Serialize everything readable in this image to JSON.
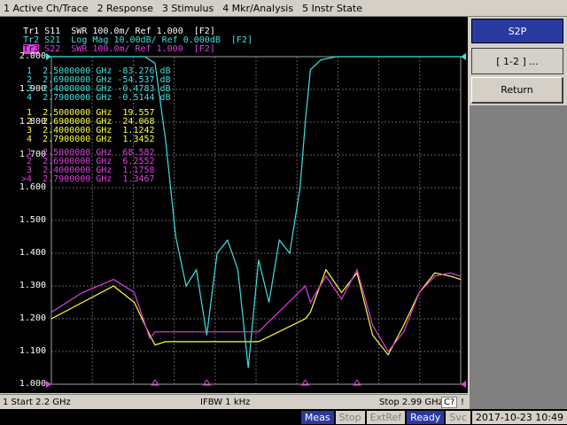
{
  "menu": {
    "items": [
      "1 Active Ch/Trace",
      "2 Response",
      "3 Stimulus",
      "4 Mkr/Analysis",
      "5 Instr State"
    ]
  },
  "traces": [
    {
      "label": "Tr1",
      "text": "S11  SWR 100.0m/ Ref 1.000  [F2]",
      "color": "#ffffff"
    },
    {
      "label": "Tr2",
      "text": "S21  Log Mag 10.00dB/ Ref 0.000dB  [F2]",
      "color": "#40e0e0"
    },
    {
      "label": "Tr3",
      "text": "S22  SWR 100.0m/ Ref 1.000  [F2]",
      "color": "#e040e0"
    }
  ],
  "markers": {
    "trace2": [
      {
        "n": "1",
        "freq": "2.5000000 GHz",
        "val": "-83.276 dB"
      },
      {
        "n": "2",
        "freq": "2.6900000 GHz",
        "val": "-54.537 dB"
      },
      {
        "n": "3",
        "freq": "2.4000000 GHz",
        "val": "-0.4783 dB"
      },
      {
        "n": "4",
        "freq": "2.7900000 GHz",
        "val": "-0.5144 dB"
      }
    ],
    "trace1": [
      {
        "n": "1",
        "freq": "2.5000000 GHz",
        "val": "19.557"
      },
      {
        "n": "2",
        "freq": "2.6900000 GHz",
        "val": "24.068"
      },
      {
        "n": "3",
        "freq": "2.4000000 GHz",
        "val": "1.1242"
      },
      {
        "n": "4",
        "freq": "2.7900000 GHz",
        "val": "1.3452"
      }
    ],
    "trace3": [
      {
        "n": "1",
        "freq": "2.5000000 GHz",
        "val": "68.582"
      },
      {
        "n": "2",
        "freq": "2.6900000 GHz",
        "val": "6.2552"
      },
      {
        "n": "3",
        "freq": "2.4000000 GHz",
        "val": "1.1758"
      },
      {
        "n": ">4",
        "freq": "2.7900000 GHz",
        "val": "1.3467"
      }
    ]
  },
  "y_ticks": [
    "2.000",
    "1.900",
    "1.800",
    "1.700",
    "1.600",
    "1.500",
    "1.400",
    "1.300",
    "1.200",
    "1.100",
    "1.000"
  ],
  "softkeys": {
    "title": "S2P",
    "item1": "[ 1-2 ] ...",
    "item2": "Return"
  },
  "channel_status": {
    "start": "1  Start 2.2 GHz",
    "ifbw": "IFBW 1 kHz",
    "stop": "Stop 2.99 GHz",
    "c_flag": "C?",
    "bang": "!"
  },
  "statusbar": {
    "meas": "Meas",
    "stop": "Stop",
    "extref": "ExtRef",
    "ready": "Ready",
    "svc": "Svc",
    "datetime": "2017-10-23 10:49"
  },
  "colors": {
    "tr1": "#ffffff",
    "tr1_plot": "#ffff40",
    "tr2": "#40e0e0",
    "tr3": "#e040e0",
    "marker_active": "#e040e0"
  },
  "chart_data": {
    "type": "line",
    "x_start_ghz": 2.2,
    "x_stop_ghz": 2.99,
    "ylim": [
      1.0,
      2.0
    ],
    "series": [
      {
        "name": "Tr1",
        "x": [
          2.2,
          2.26,
          2.32,
          2.36,
          2.39,
          2.4,
          2.42,
          2.6,
          2.69,
          2.7,
          2.73,
          2.76,
          2.79,
          2.82,
          2.85,
          2.88,
          2.91,
          2.94,
          2.97,
          2.99
        ],
        "y": [
          1.2,
          1.25,
          1.3,
          1.25,
          1.15,
          1.12,
          1.13,
          1.13,
          1.2,
          1.22,
          1.35,
          1.28,
          1.34,
          1.15,
          1.09,
          1.18,
          1.28,
          1.34,
          1.33,
          1.32
        ]
      },
      {
        "name": "Tr2",
        "x": [
          2.2,
          2.3,
          2.35,
          2.38,
          2.4,
          2.42,
          2.44,
          2.46,
          2.48,
          2.5,
          2.52,
          2.54,
          2.56,
          2.58,
          2.6,
          2.62,
          2.64,
          2.66,
          2.68,
          2.69,
          2.7,
          2.72,
          2.75,
          2.79,
          2.85,
          2.95,
          2.99
        ],
        "y": [
          2.0,
          2.0,
          2.0,
          2.0,
          1.98,
          1.75,
          1.45,
          1.3,
          1.35,
          1.15,
          1.4,
          1.44,
          1.35,
          1.05,
          1.38,
          1.25,
          1.44,
          1.4,
          1.6,
          1.8,
          1.96,
          1.99,
          2.0,
          2.0,
          2.0,
          2.0,
          2.0
        ]
      },
      {
        "name": "Tr3",
        "x": [
          2.2,
          2.26,
          2.32,
          2.36,
          2.39,
          2.4,
          2.42,
          2.6,
          2.69,
          2.7,
          2.73,
          2.76,
          2.79,
          2.82,
          2.85,
          2.88,
          2.91,
          2.94,
          2.97,
          2.99
        ],
        "y": [
          1.22,
          1.28,
          1.32,
          1.28,
          1.14,
          1.16,
          1.16,
          1.16,
          1.3,
          1.25,
          1.33,
          1.26,
          1.35,
          1.18,
          1.1,
          1.16,
          1.28,
          1.33,
          1.34,
          1.33
        ]
      }
    ]
  }
}
